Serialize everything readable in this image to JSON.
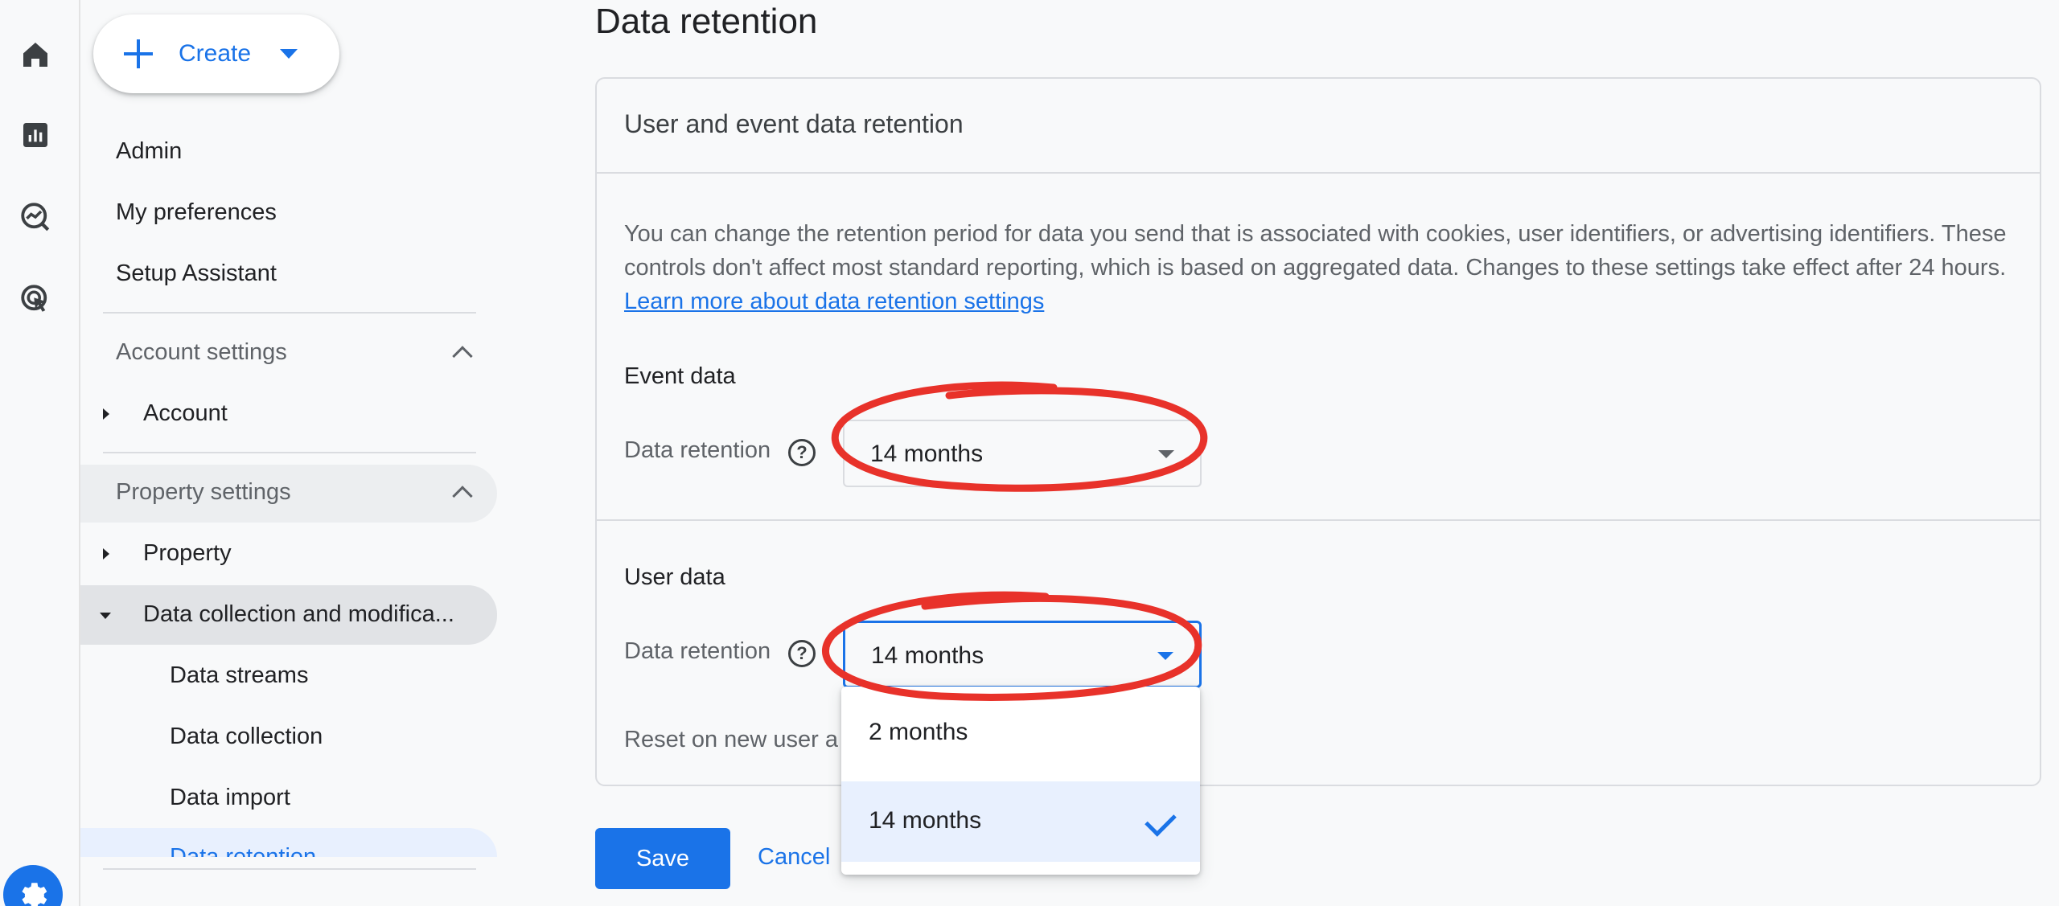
{
  "rail": {
    "icons": [
      "home-icon",
      "reports-icon",
      "explore-icon",
      "advertising-icon"
    ],
    "bottom_icon": "gear-icon"
  },
  "nav": {
    "create_label": "Create",
    "top_items": [
      "Admin",
      "My preferences",
      "Setup Assistant"
    ],
    "account_section": "Account settings",
    "account_item": "Account",
    "property_section": "Property settings",
    "property_item": "Property",
    "data_collection_item": "Data collection and modifica...",
    "sub_items": [
      "Data streams",
      "Data collection",
      "Data import",
      "Data retention"
    ]
  },
  "page": {
    "title": "Data retention"
  },
  "card": {
    "title": "User and event data retention",
    "description": "You can change the retention period for data you send that is associated with cookies, user identifiers, or advertising identifiers. These controls don't affect most standard reporting, which is based on aggregated data. Changes to these settings take effect after 24 hours.",
    "learn_more_link": "Learn more about data retention settings",
    "event_data_heading": "Event data",
    "event_retention_label": "Data retention",
    "event_retention_value": "14 months",
    "user_data_heading": "User data",
    "user_retention_label": "Data retention",
    "user_retention_value": "14 months",
    "reset_label": "Reset on new user a"
  },
  "dropdown": {
    "options": [
      "2 months",
      "14 months"
    ],
    "selected": "14 months"
  },
  "actions": {
    "save_label": "Save",
    "cancel_label": "Cancel"
  },
  "colors": {
    "accent": "#1a73e8",
    "annotation": "#e8322a"
  }
}
